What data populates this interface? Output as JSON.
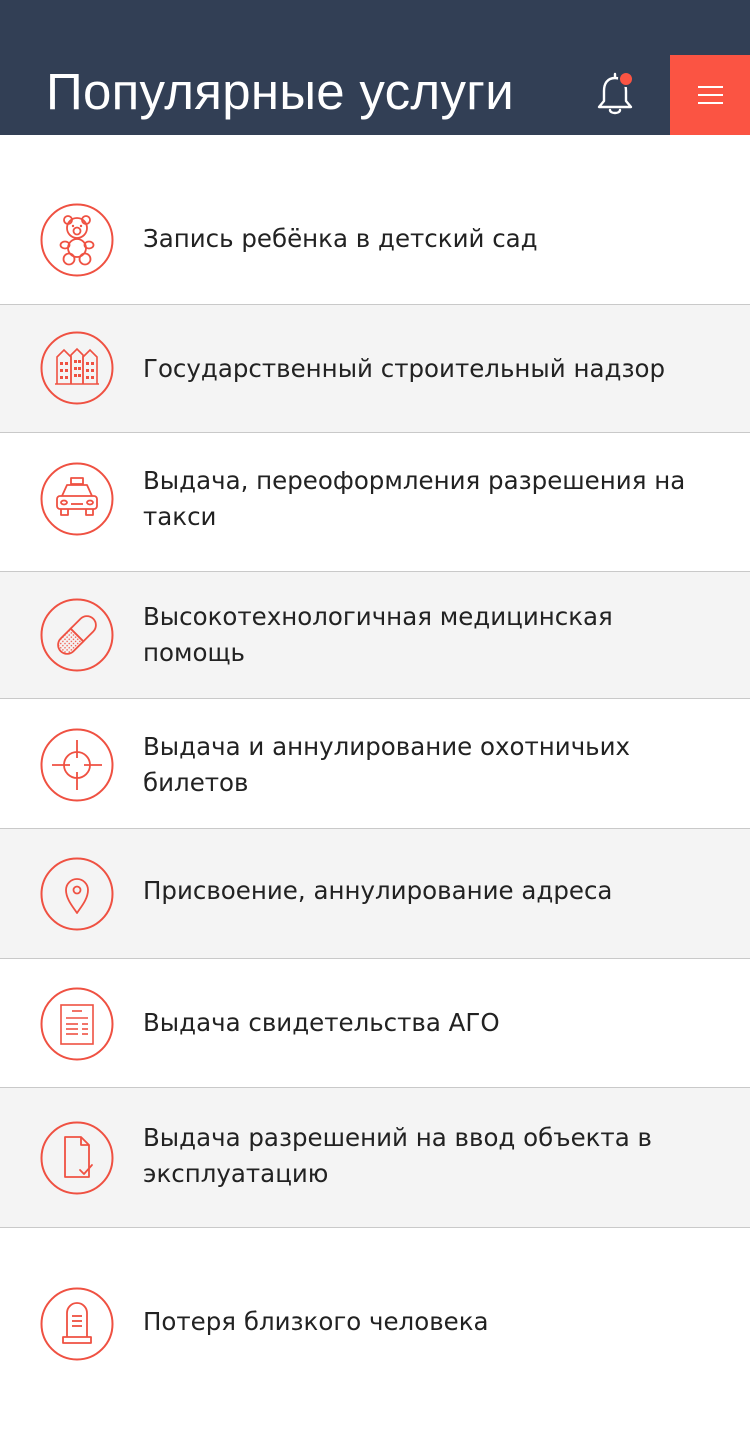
{
  "header": {
    "title": "Популярные услуги",
    "bell_icon": "bell-icon",
    "has_notification": true,
    "menu_icon": "hamburger-menu-icon"
  },
  "colors": {
    "header_bg": "#323f55",
    "accent": "#fb5443",
    "icon_stroke": "#ef5142",
    "alt_row_bg": "#f4f4f4",
    "divider": "#c9c9c9",
    "text": "#222222"
  },
  "services": [
    {
      "label": "Запись ребёнка в детский сад",
      "icon": "teddy-bear-icon"
    },
    {
      "label": "Государственный строительный надзор",
      "icon": "buildings-icon"
    },
    {
      "label": "Выдача, переоформления разрешения на такси",
      "icon": "taxi-icon"
    },
    {
      "label": "Высокотехнологичная медицинская помощь",
      "icon": "pill-capsule-icon"
    },
    {
      "label": "Выдача и аннулирование охотничьих билетов",
      "icon": "crosshair-icon"
    },
    {
      "label": "Присвоение, аннулирование адреса",
      "icon": "map-pin-icon"
    },
    {
      "label": "Выдача свидетельства АГО",
      "icon": "document-icon"
    },
    {
      "label": "Выдача разрешений на ввод объекта в эксплуатацию",
      "icon": "file-check-icon"
    },
    {
      "label": "Потеря близкого человека",
      "icon": "gravestone-icon"
    }
  ]
}
